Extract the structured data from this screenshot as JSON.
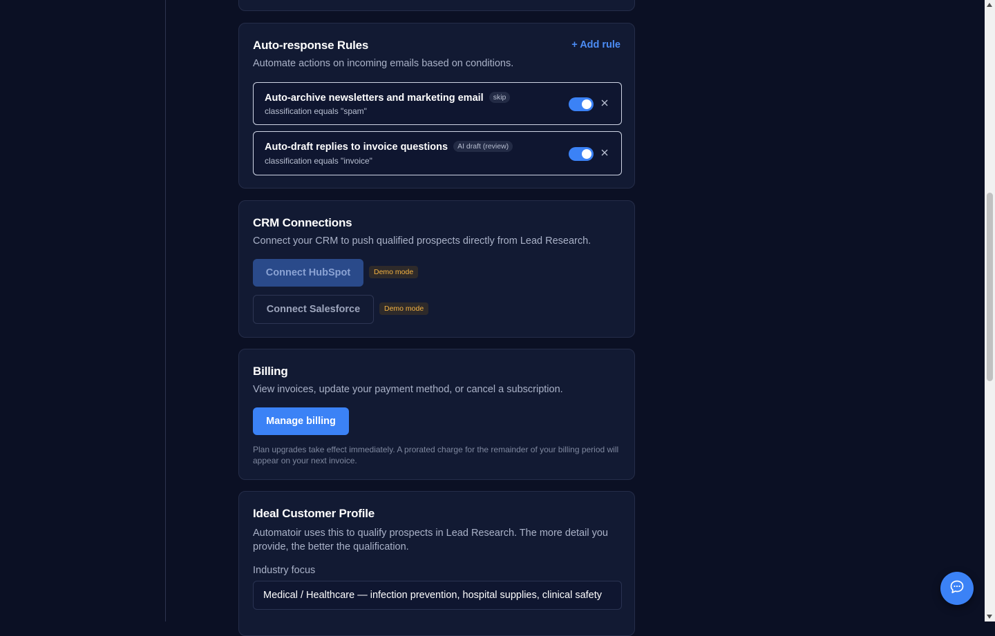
{
  "auto_response": {
    "title": "Auto-response Rules",
    "description": "Automate actions on incoming emails based on conditions.",
    "add_rule_label": "+ Add rule",
    "rules": [
      {
        "title": "Auto-archive newsletters and marketing email",
        "badge": "skip",
        "condition": "classification equals \"spam\"",
        "enabled": true
      },
      {
        "title": "Auto-draft replies to invoice questions",
        "badge": "AI draft (review)",
        "condition": "classification equals \"invoice\"",
        "enabled": true
      }
    ]
  },
  "crm": {
    "title": "CRM Connections",
    "description": "Connect your CRM to push qualified prospects directly from Lead Research.",
    "hubspot_button": "Connect HubSpot",
    "hubspot_badge": "Demo mode",
    "salesforce_button": "Connect Salesforce",
    "salesforce_badge": "Demo mode"
  },
  "billing": {
    "title": "Billing",
    "description": "View invoices, update your payment method, or cancel a subscription.",
    "manage_button": "Manage billing",
    "fineprint": "Plan upgrades take effect immediately. A prorated charge for the remainder of your billing period will appear on your next invoice."
  },
  "icp": {
    "title": "Ideal Customer Profile",
    "description": "Automatoir uses this to qualify prospects in Lead Research. The more detail you provide, the better the qualification.",
    "industry_label": "Industry focus",
    "industry_value": "Medical / Healthcare — infection prevention, hospital supplies, clinical safety"
  },
  "icons": {
    "close": "close-icon",
    "chat": "chat-bubble-icon"
  },
  "colors": {
    "accent": "#3b82f6",
    "background": "#0b1024",
    "card": "#121a33",
    "demo_badge": "#f5b342"
  }
}
